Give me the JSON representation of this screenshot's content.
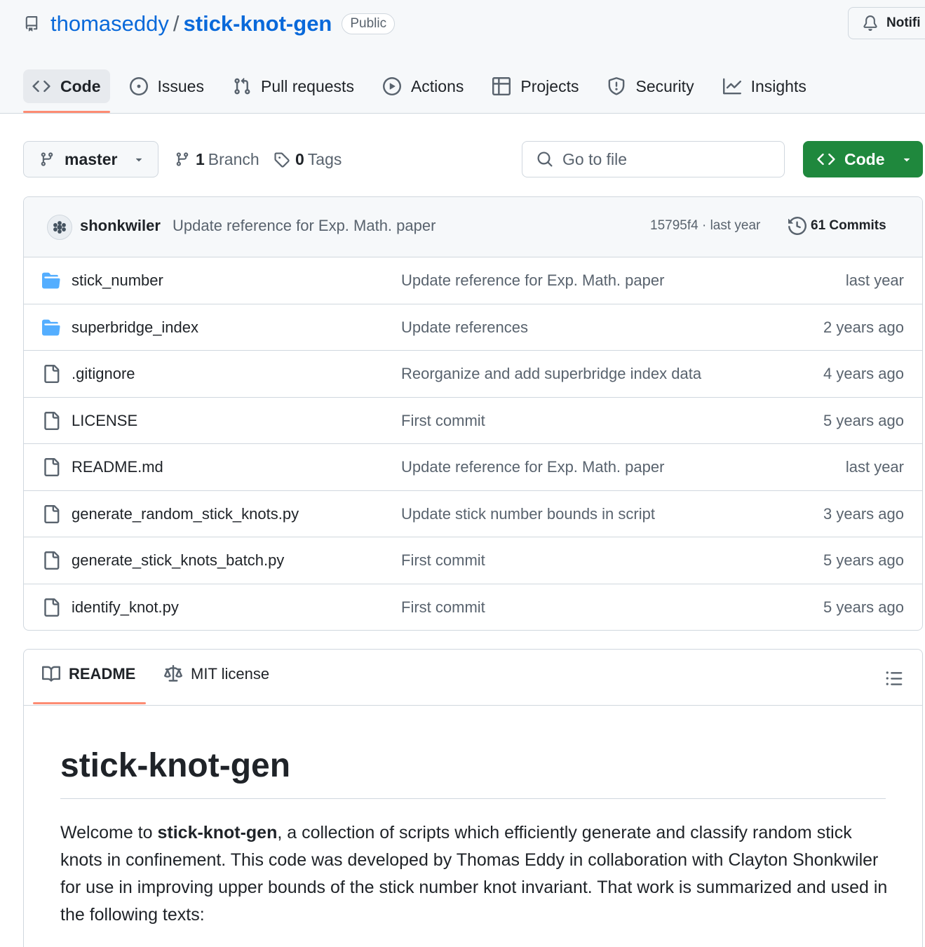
{
  "repo": {
    "owner": "thomaseddy",
    "separator": "/",
    "name": "stick-knot-gen",
    "visibility": "Public",
    "notifications_label": "Notifi"
  },
  "tabs": [
    {
      "label": "Code",
      "icon": "code-icon",
      "active": true
    },
    {
      "label": "Issues",
      "icon": "issue-opened-icon"
    },
    {
      "label": "Pull requests",
      "icon": "git-pull-request-icon"
    },
    {
      "label": "Actions",
      "icon": "play-icon"
    },
    {
      "label": "Projects",
      "icon": "table-icon"
    },
    {
      "label": "Security",
      "icon": "shield-icon"
    },
    {
      "label": "Insights",
      "icon": "graph-icon"
    }
  ],
  "branch_bar": {
    "branch": "master",
    "branch_count": "1",
    "branch_label": "Branch",
    "tag_count": "0",
    "tag_label": "Tags",
    "search_placeholder": "Go to file",
    "code_button": "Code"
  },
  "latest_commit": {
    "author": "shonkwiler",
    "message": "Update reference for Exp. Math. paper",
    "hash_time": "15795f4 · last year",
    "commits_label": "61 Commits"
  },
  "files": [
    {
      "name": "stick_number",
      "type": "folder",
      "message": "Update reference for Exp. Math. paper",
      "age": "last year"
    },
    {
      "name": "superbridge_index",
      "type": "folder",
      "message": "Update references",
      "age": "2 years ago"
    },
    {
      "name": ".gitignore",
      "type": "file",
      "message": "Reorganize and add superbridge index data",
      "age": "4 years ago"
    },
    {
      "name": "LICENSE",
      "type": "file",
      "message": "First commit",
      "age": "5 years ago"
    },
    {
      "name": "README.md",
      "type": "file",
      "message": "Update reference for Exp. Math. paper",
      "age": "last year"
    },
    {
      "name": "generate_random_stick_knots.py",
      "type": "file",
      "message": "Update stick number bounds in script",
      "age": "3 years ago"
    },
    {
      "name": "generate_stick_knots_batch.py",
      "type": "file",
      "message": "First commit",
      "age": "5 years ago"
    },
    {
      "name": "identify_knot.py",
      "type": "file",
      "message": "First commit",
      "age": "5 years ago"
    }
  ],
  "readme": {
    "tab_readme": "README",
    "tab_license": "MIT license",
    "title": "stick-knot-gen",
    "para_prefix": "Welcome to ",
    "para_bold": "stick-knot-gen",
    "para_rest": ", a collection of scripts which efficiently generate and classify random stick knots in confinement. This code was developed by Thomas Eddy in collaboration with Clayton Shonkwiler for use in improving upper bounds of the stick number knot invariant. That work is summarized and used in the following texts:"
  },
  "colors": {
    "link": "#0969da",
    "primary_button": "#1f883d",
    "tab_underline": "#fd8c73",
    "folder": "#54aeff",
    "muted_text": "#59636e",
    "border": "#d0d7de"
  }
}
